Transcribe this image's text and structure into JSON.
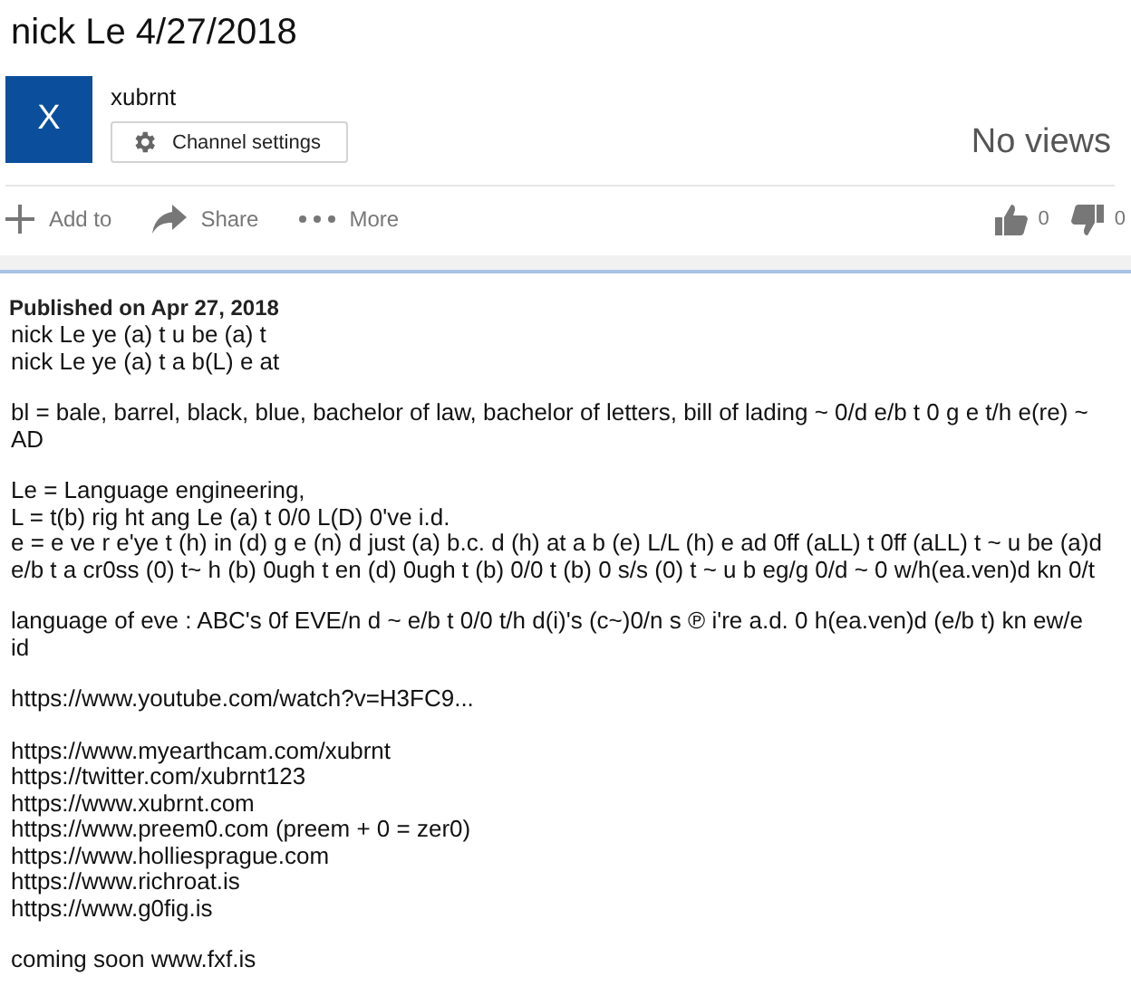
{
  "video": {
    "title": "nick Le 4/27/2018",
    "channel": {
      "avatar_letter": "X",
      "name": "xubrnt",
      "settings_button": "Channel settings"
    },
    "views": "No views",
    "actions": [
      {
        "kind": "add",
        "label": "Add to"
      },
      {
        "kind": "share",
        "label": "Share"
      },
      {
        "kind": "more",
        "label": "More"
      }
    ],
    "likes": "0",
    "dislikes": "0"
  },
  "description": {
    "published": "Published on Apr 27, 2018",
    "paragraphs": [
      [
        "nick Le ye (a) t u be (a) t",
        "nick Le ye (a) t a b(L) e at"
      ],
      [
        "bl = bale, barrel, black, blue, bachelor of law, bachelor of letters, bill of lading ~ 0/d e/b t 0 g e t/h e(re) ~ AD"
      ],
      [
        "Le = Language engineering,",
        "L = t(b) rig ht ang Le (a) t 0/0 L(D) 0've i.d.",
        "e = e ve r e'ye t (h) in (d) g e (n) d just (a) b.c. d (h) at a b (e) L/L (h) e ad 0ff (aLL) t 0ff (aLL) t ~ u be (a)d e/b t a cr0ss (0) t~ h (b) 0ugh t en (d) 0ugh t (b) 0/0 t (b) 0 s/s (0) t ~ u b eg/g 0/d ~ 0 w/h(ea.ven)d kn 0/t"
      ],
      [
        "language of eve : ABC's 0f EVE/n d ~ e/b t 0/0 t/h d(i)'s (c~)0/n s ℗ i're a.d. 0 h(ea.ven)d (e/b t) kn ew/e id"
      ],
      [
        "https://www.youtube.com/watch?v=H3FC9..."
      ],
      [
        "https://www.myearthcam.com/xubrnt",
        "https://twitter.com/xubrnt123",
        "https://www.xubrnt.com",
        "https://www.preem0.com (preem + 0 = zer0)",
        "https://www.holliesprague.com",
        "https://www.richroat.is",
        "https://www.g0fig.is"
      ],
      [
        "coming soon www.fxf.is"
      ]
    ]
  }
}
